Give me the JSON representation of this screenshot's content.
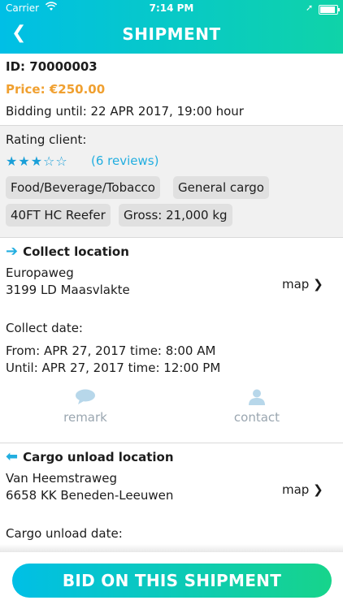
{
  "status_bar": {
    "carrier": "Carrier",
    "time": "7:14 PM"
  },
  "nav": {
    "back_glyph": "❮",
    "title": "SHIPMENT"
  },
  "shipment": {
    "id": "ID: 70000003",
    "price": "Price: €250.00",
    "bidding_until": "Bidding until: 22 APR 2017, 19:00 hour"
  },
  "rating": {
    "label": "Rating client:",
    "stars_filled": 3,
    "stars_total": 5,
    "reviews": "(6 reviews)",
    "star_color": "#1a9fd8"
  },
  "tags": [
    "Food/Beverage/Tobacco",
    "General cargo",
    "40FT HC Reefer",
    "Gross: 21,000 kg"
  ],
  "collect": {
    "heading": "Collect location",
    "address_line1": "Europaweg",
    "address_line2": "3199 LD Maasvlakte",
    "map_label": "map ❯",
    "date_label": "Collect date:",
    "from": "From: APR 27, 2017 time: 8:00 AM",
    "until": "Until: APR 27, 2017 time: 12:00 PM",
    "remark_label": "remark",
    "contact_label": "contact"
  },
  "unload": {
    "heading": "Cargo unload location",
    "address_line1": "Van Heemstraweg",
    "address_line2": "6658 KK Beneden-Leeuwen",
    "map_label": "map ❯",
    "date_label": "Cargo unload date:"
  },
  "footer": {
    "bid_label": "BID ON THIS SHIPMENT"
  },
  "colors": {
    "accent": "#22aee0",
    "price": "#f0a030",
    "gradient_start": "#00bfe6",
    "gradient_end": "#17d48b"
  }
}
